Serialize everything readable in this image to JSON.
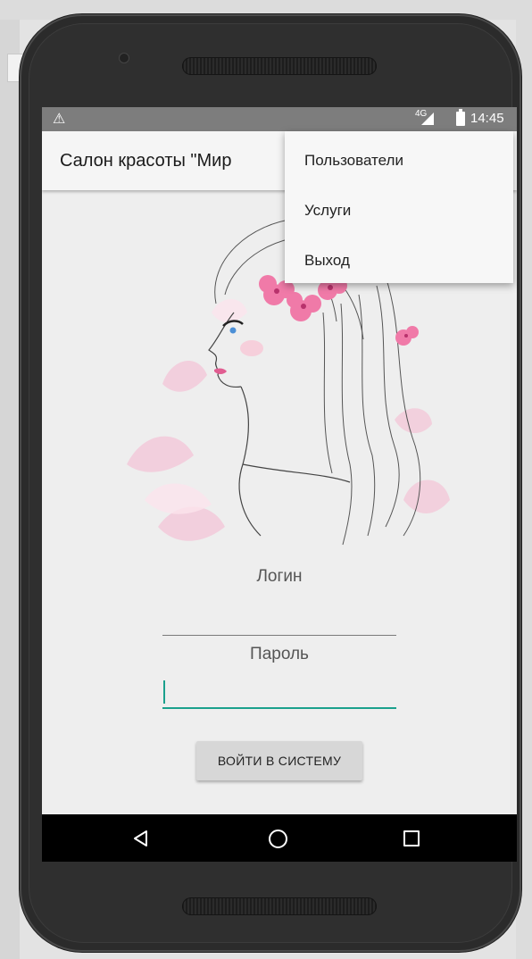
{
  "status_bar": {
    "warning_icon": "warning-triangle-icon",
    "network": "4G",
    "time": "14:45"
  },
  "app_bar": {
    "title": "Салон красоты \"Мир"
  },
  "overflow_menu": {
    "items": [
      {
        "label": "Пользователи"
      },
      {
        "label": "Услуги"
      },
      {
        "label": "Выход"
      }
    ]
  },
  "form": {
    "login_label": "Логин",
    "login_value": "",
    "password_label": "Пароль",
    "password_value": "",
    "submit_label": "ВОЙТИ В СИСТЕМУ"
  },
  "nav_bar": {
    "back_icon": "back-triangle-icon",
    "home_icon": "home-circle-icon",
    "recents_icon": "recents-square-icon"
  },
  "colors": {
    "accent": "#1aa08c",
    "status_bar": "#7d7d7d",
    "nav_bar": "#000000",
    "screen_bg": "#eeeeee",
    "flowers": "#f07aa8"
  }
}
